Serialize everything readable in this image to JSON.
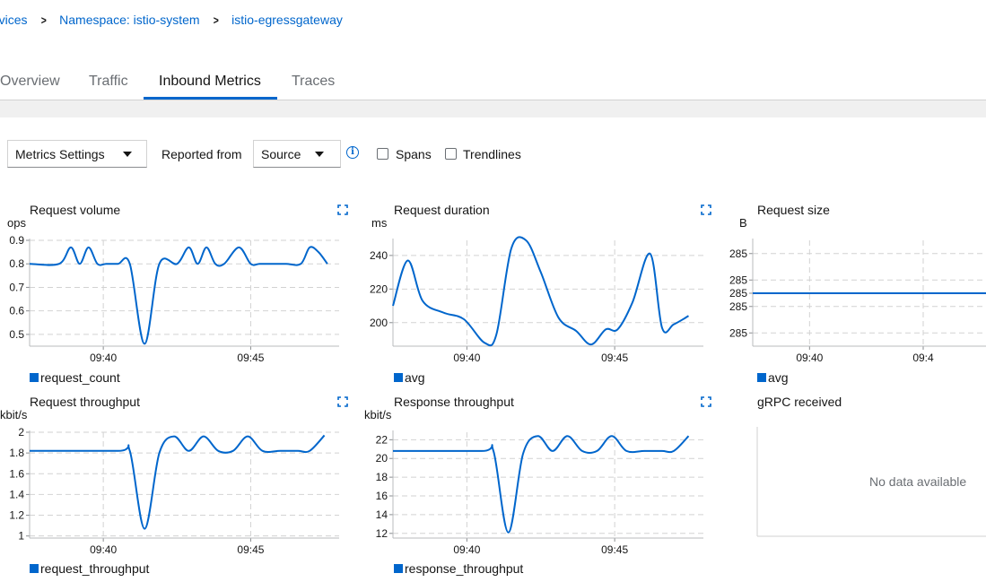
{
  "breadcrumb": {
    "items": [
      "rvices",
      "Namespace: istio-system",
      "istio-egressgateway"
    ]
  },
  "tabs": [
    "Overview",
    "Traffic",
    "Inbound Metrics",
    "Traces"
  ],
  "active_tab": "Inbound Metrics",
  "toolbar": {
    "metrics_settings_label": "Metrics Settings",
    "reported_from_label": "Reported from",
    "reported_from_value": "Source",
    "spans_label": "Spans",
    "trendlines_label": "Trendlines"
  },
  "colors": {
    "accent": "#0066cc",
    "grid": "#d2d2d2"
  },
  "icons": [
    "expand-icon",
    "info-icon",
    "caret-down-icon"
  ],
  "panels": {
    "request_volume": {
      "title": "Request volume",
      "unit": "ops",
      "legend": "request_count"
    },
    "request_duration": {
      "title": "Request duration",
      "unit": "ms",
      "legend": "avg"
    },
    "request_size": {
      "title": "Request size",
      "unit": "B",
      "legend": "avg"
    },
    "request_throughput": {
      "title": "Request throughput",
      "unit": "kbit/s",
      "legend": "request_throughput"
    },
    "response_throughput": {
      "title": "Response throughput",
      "unit": "kbit/s",
      "legend": "response_throughput"
    },
    "grpc_received": {
      "title": "gRPC received",
      "no_data": "No data available"
    }
  },
  "chart_data": [
    {
      "id": "request_volume",
      "type": "line",
      "title": "Request volume",
      "ylabel": "ops",
      "x_ticks": [
        "09:40",
        "09:45"
      ],
      "y_ticks": [
        "0.9",
        "0.8",
        "0.7",
        "0.6",
        "0.5"
      ],
      "xlim": [
        37.5,
        48
      ],
      "ylim": [
        0.45,
        0.9
      ],
      "series": [
        {
          "name": "request_count",
          "x": [
            37.5,
            38.5,
            38.9,
            39.2,
            39.5,
            39.8,
            40.1,
            40.5,
            40.9,
            41.4,
            41.9,
            42.5,
            42.9,
            43.2,
            43.5,
            43.8,
            44.1,
            44.6,
            45.0,
            45.3,
            45.7,
            46.2,
            46.7,
            47.0,
            47.3,
            47.6
          ],
          "y": [
            0.8,
            0.8,
            0.87,
            0.8,
            0.87,
            0.8,
            0.8,
            0.8,
            0.8,
            0.46,
            0.8,
            0.8,
            0.87,
            0.8,
            0.87,
            0.8,
            0.8,
            0.87,
            0.8,
            0.8,
            0.8,
            0.8,
            0.8,
            0.87,
            0.85,
            0.8
          ]
        }
      ]
    },
    {
      "id": "request_duration",
      "type": "line",
      "title": "Request duration",
      "ylabel": "ms",
      "x_ticks": [
        "09:40",
        "09:45"
      ],
      "y_ticks": [
        "240",
        "220",
        "200"
      ],
      "xlim": [
        37.5,
        48
      ],
      "ylim": [
        186,
        249
      ],
      "series": [
        {
          "name": "avg",
          "x": [
            37.5,
            38.0,
            38.5,
            39.2,
            39.9,
            40.6,
            41.0,
            41.5,
            42.0,
            42.5,
            43.1,
            43.7,
            44.2,
            44.7,
            45.1,
            45.6,
            46.2,
            46.6,
            47.0,
            47.5
          ],
          "y": [
            210,
            237,
            213,
            206,
            202,
            188,
            193,
            244,
            249,
            230,
            203,
            195,
            187,
            196,
            196,
            212,
            241,
            197,
            199,
            204
          ]
        }
      ]
    },
    {
      "id": "request_size",
      "type": "line",
      "title": "Request size",
      "ylabel": "B",
      "x_ticks": [
        "09:40",
        "09:4"
      ],
      "y_ticks": [
        "285",
        "285",
        "285",
        "285",
        "285"
      ],
      "xlim": [
        37.5,
        48
      ],
      "ylim": [
        284.8,
        285.2
      ],
      "series": [
        {
          "name": "avg",
          "x": [
            37.5,
            48
          ],
          "y": [
            285,
            285
          ]
        }
      ]
    },
    {
      "id": "request_throughput",
      "type": "line",
      "title": "Request throughput",
      "ylabel": "kbit/s",
      "x_ticks": [
        "09:40",
        "09:45"
      ],
      "y_ticks": [
        "2",
        "1.8",
        "1.6",
        "1.4",
        "1.2",
        "1"
      ],
      "xlim": [
        37.5,
        48
      ],
      "ylim": [
        0.98,
        2.0
      ],
      "series": [
        {
          "name": "request_throughput",
          "x": [
            37.5,
            40.5,
            40.9,
            41.4,
            41.9,
            42.4,
            42.9,
            43.4,
            43.9,
            44.4,
            44.9,
            45.4,
            46.0,
            46.6,
            47.0,
            47.5
          ],
          "y": [
            1.82,
            1.82,
            1.82,
            1.07,
            1.8,
            1.96,
            1.82,
            1.96,
            1.82,
            1.82,
            1.96,
            1.82,
            1.82,
            1.82,
            1.82,
            1.97
          ]
        }
      ]
    },
    {
      "id": "response_throughput",
      "type": "line",
      "title": "Response throughput",
      "ylabel": "kbit/s",
      "x_ticks": [
        "09:40",
        "09:45"
      ],
      "y_ticks": [
        "22",
        "20",
        "18",
        "16",
        "14",
        "12"
      ],
      "xlim": [
        37.5,
        48
      ],
      "ylim": [
        11.5,
        22.8
      ],
      "series": [
        {
          "name": "response_throughput",
          "x": [
            37.5,
            40.5,
            40.9,
            41.4,
            41.9,
            42.4,
            42.9,
            43.4,
            43.9,
            44.4,
            44.9,
            45.4,
            46.0,
            46.6,
            47.0,
            47.5
          ],
          "y": [
            20.8,
            20.8,
            20.8,
            12.1,
            20.5,
            22.4,
            20.8,
            22.4,
            20.8,
            20.8,
            22.4,
            20.8,
            20.8,
            20.8,
            20.8,
            22.4
          ]
        }
      ]
    },
    {
      "id": "grpc_received",
      "type": "line",
      "title": "gRPC received",
      "series": []
    }
  ]
}
